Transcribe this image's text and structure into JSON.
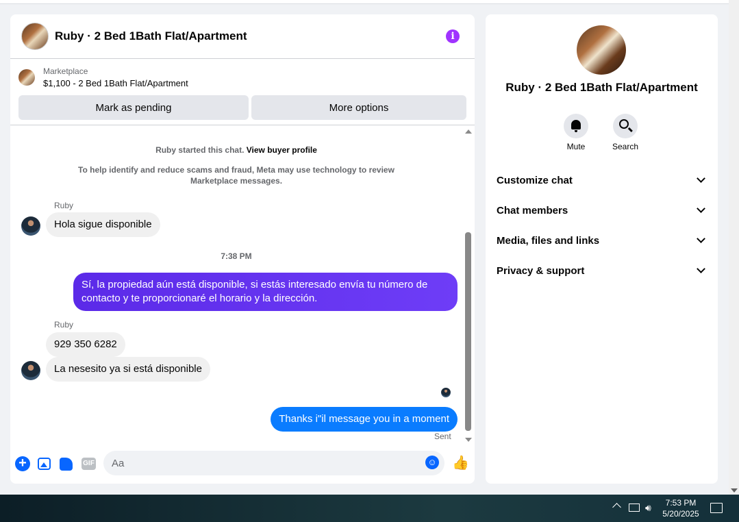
{
  "chat": {
    "title": "Ruby · 2 Bed 1Bath Flat/Apartment",
    "marketplace_label": "Marketplace",
    "listing": "$1,100 - 2 Bed 1Bath Flat/Apartment",
    "btn_pending": "Mark as pending",
    "btn_more": "More options",
    "started_prefix": "Ruby started this chat.",
    "started_link": "View buyer profile",
    "scam_notice_1": "To help identify and reduce scams and fraud, Meta may use technology to review",
    "scam_notice_2": "Marketplace messages.",
    "messages": [
      {
        "sender": "Ruby",
        "text": "Hola sigue disponible"
      },
      {
        "time": "7:38 PM"
      },
      {
        "text_1": "Sí, la propiedad aún está disponible, si estás interesado envía tu número de",
        "text_2": "contacto y te proporcionaré el horario y la dirección."
      },
      {
        "sender": "Ruby",
        "text": "929 350 6282"
      },
      {
        "text": "La nesesito ya si está disponible"
      },
      {
        "text": "Thanks i\"il message you in a moment",
        "status": "Sent"
      }
    ],
    "composer_placeholder": "Aa"
  },
  "info": {
    "title": "Ruby · 2 Bed 1Bath Flat/Apartment",
    "mute": "Mute",
    "search": "Search",
    "sections": [
      "Customize chat",
      "Chat members",
      "Media, files and links",
      "Privacy & support"
    ]
  },
  "taskbar": {
    "time": "7:53 PM",
    "date": "5/20/2025"
  },
  "colors": {
    "accent": "#0866ff",
    "outgoing": "#0a7cff",
    "info_icon": "#a033ff"
  }
}
